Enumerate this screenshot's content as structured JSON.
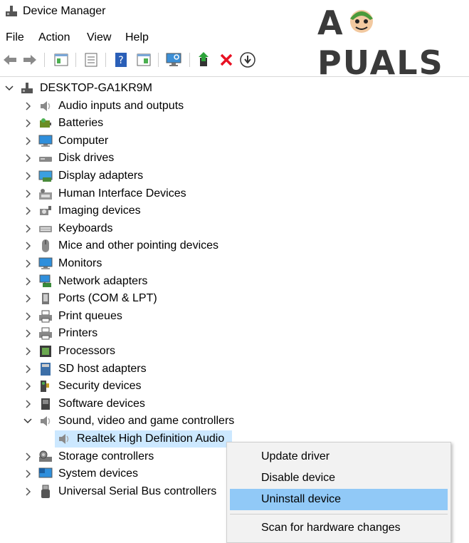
{
  "window": {
    "title": "Device Manager"
  },
  "watermark": {
    "text_left": "A",
    "text_right": "PUALS"
  },
  "menu": [
    "File",
    "Action",
    "View",
    "Help"
  ],
  "toolbar": [
    "back-icon",
    "forward-icon",
    "properties-icon",
    "show-hide-icon",
    "help-icon",
    "view-icon",
    "scan-icon",
    "update-driver-icon",
    "uninstall-icon",
    "download-icon"
  ],
  "tree": {
    "root": "DESKTOP-GA1KR9M",
    "categories": [
      {
        "label": "Audio inputs and outputs",
        "icon": "speaker-icon",
        "expanded": false
      },
      {
        "label": "Batteries",
        "icon": "battery-icon",
        "expanded": false
      },
      {
        "label": "Computer",
        "icon": "monitor-icon",
        "expanded": false
      },
      {
        "label": "Disk drives",
        "icon": "disk-icon",
        "expanded": false
      },
      {
        "label": "Display adapters",
        "icon": "display-adapter-icon",
        "expanded": false
      },
      {
        "label": "Human Interface Devices",
        "icon": "hid-icon",
        "expanded": false
      },
      {
        "label": "Imaging devices",
        "icon": "camera-icon",
        "expanded": false
      },
      {
        "label": "Keyboards",
        "icon": "keyboard-icon",
        "expanded": false
      },
      {
        "label": "Mice and other pointing devices",
        "icon": "mouse-icon",
        "expanded": false
      },
      {
        "label": "Monitors",
        "icon": "monitor-icon",
        "expanded": false
      },
      {
        "label": "Network adapters",
        "icon": "network-icon",
        "expanded": false
      },
      {
        "label": "Ports (COM & LPT)",
        "icon": "port-icon",
        "expanded": false
      },
      {
        "label": "Print queues",
        "icon": "printer-icon",
        "expanded": false
      },
      {
        "label": "Printers",
        "icon": "printer-icon",
        "expanded": false
      },
      {
        "label": "Processors",
        "icon": "chip-icon",
        "expanded": false
      },
      {
        "label": "SD host adapters",
        "icon": "sd-card-icon",
        "expanded": false
      },
      {
        "label": "Security devices",
        "icon": "security-key-icon",
        "expanded": false
      },
      {
        "label": "Software devices",
        "icon": "software-device-icon",
        "expanded": false
      },
      {
        "label": "Sound, video and game controllers",
        "icon": "speaker-icon",
        "expanded": true
      },
      {
        "label": "Realtek High Definition Audio",
        "icon": "speaker-icon",
        "child": true,
        "selected": true
      },
      {
        "label": "Storage controllers",
        "icon": "storage-icon",
        "expanded": false
      },
      {
        "label": "System devices",
        "icon": "system-icon",
        "expanded": false
      },
      {
        "label": "Universal Serial Bus controllers",
        "icon": "usb-icon",
        "expanded": false
      }
    ]
  },
  "context_menu": {
    "items": [
      "Update driver",
      "Disable device",
      "Uninstall device",
      "Scan for hardware changes"
    ],
    "highlighted": "Uninstall device"
  },
  "colors": {
    "selection": "#cce8ff",
    "menu_highlight": "#91c9f7",
    "uninstall_red": "#e81123",
    "update_green": "#107c10"
  }
}
